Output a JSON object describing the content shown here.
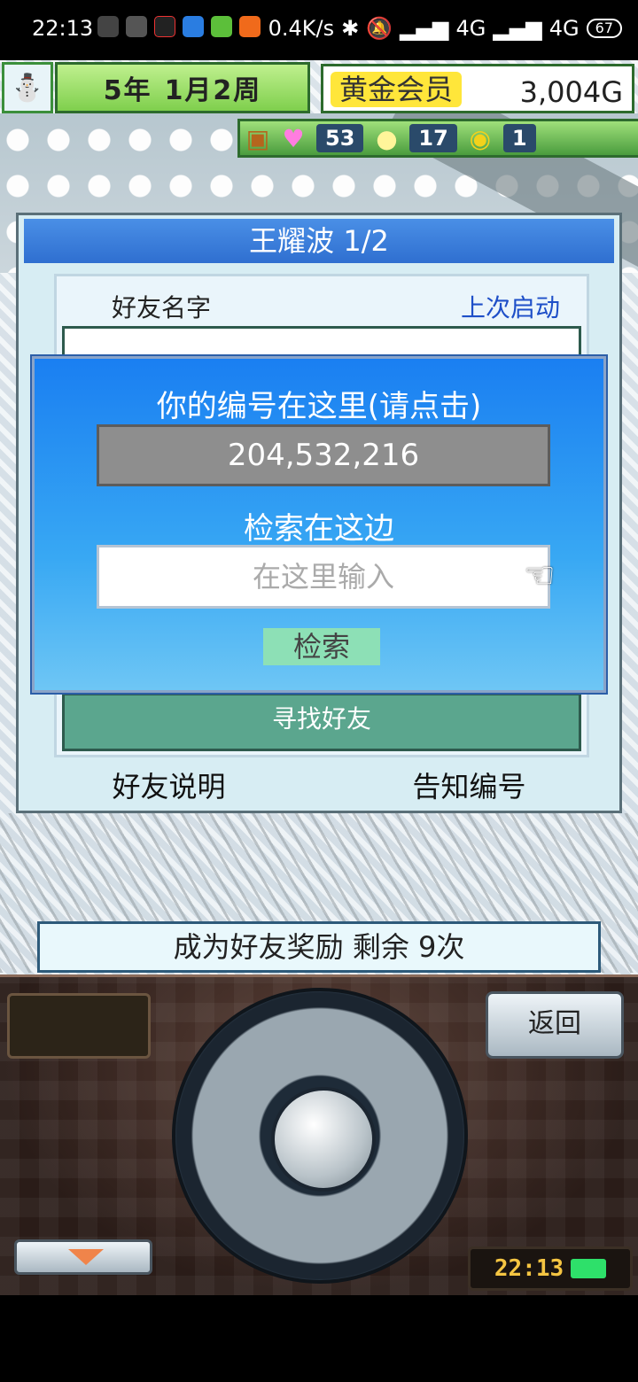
{
  "status_bar": {
    "time": "22:13",
    "network_speed": "0.4K/s",
    "signal1": "4G",
    "signal2": "4G",
    "battery": "67"
  },
  "hud": {
    "date_year": "5年",
    "date_week": "1月2周",
    "member_label": "黄金会员",
    "gold": "3,004G",
    "hearts_count": "53",
    "ideas_count": "17",
    "coins_count": "1"
  },
  "panel": {
    "title": "王耀波 1/2",
    "col_friend_name": "好友名字",
    "col_last_start": "上次启动",
    "find_friend_label": "寻找好友",
    "friend_explain_label": "好友说明",
    "notify_number_label": "告知编号"
  },
  "dialog": {
    "id_prompt": "你的编号在这里(请点击)",
    "id_number": "204,532,216",
    "search_prompt": "检索在这边",
    "search_placeholder": "在这里输入",
    "search_button": "检索"
  },
  "reward": {
    "text": "成为好友奖励 剩余 9次"
  },
  "controller": {
    "back_label": "返回",
    "clock": "22:13"
  }
}
